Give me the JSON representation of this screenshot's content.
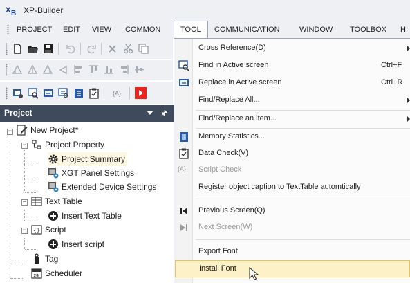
{
  "app": {
    "title": "XP-Builder"
  },
  "menubar": {
    "items": [
      {
        "label": "PROJECT"
      },
      {
        "label": "EDIT"
      },
      {
        "label": "VIEW"
      },
      {
        "label": "COMMON"
      },
      {
        "label": "TOOL"
      },
      {
        "label": "COMMUNICATION"
      },
      {
        "label": "WINDOW"
      },
      {
        "label": "TOOLBOX"
      },
      {
        "label": "HI"
      }
    ]
  },
  "project_panel": {
    "title": "Project",
    "tree": [
      {
        "label": "New Project*"
      },
      {
        "label": "Project Property"
      },
      {
        "label": "Project Summary"
      },
      {
        "label": "XGT Panel Settings"
      },
      {
        "label": "Extended Device Settings"
      },
      {
        "label": "Text Table"
      },
      {
        "label": "Insert Text Table"
      },
      {
        "label": "Script"
      },
      {
        "label": "Insert script"
      },
      {
        "label": "Tag"
      },
      {
        "label": "Scheduler"
      }
    ]
  },
  "tool_menu": {
    "items": [
      {
        "label": "Cross Reference(D)",
        "shortcut": ""
      },
      {
        "label": "Find in Active screen",
        "shortcut": "Ctrl+F"
      },
      {
        "label": "Replace in Active screen",
        "shortcut": "Ctrl+R"
      },
      {
        "label": "Find/Replace All...",
        "shortcut": ""
      },
      {
        "label": "Find/Replace an item...",
        "shortcut": ""
      },
      {
        "label": "Memory Statistics...",
        "shortcut": ""
      },
      {
        "label": "Data Check(V)",
        "shortcut": ""
      },
      {
        "label": "Script Check",
        "shortcut": ""
      },
      {
        "label": "Register object caption to TextTable automtically",
        "shortcut": ""
      },
      {
        "label": "Previous Screen(Q)",
        "shortcut": ""
      },
      {
        "label": "Next Screen(W)",
        "shortcut": ""
      },
      {
        "label": "Export Font",
        "shortcut": ""
      },
      {
        "label": "Install Font",
        "shortcut": ""
      }
    ],
    "script_check_icon_text": "{A}"
  },
  "toolbar": {
    "label_button_text": "{A}"
  },
  "colors": {
    "panel_header": "#3f4a5c",
    "menu_highlight": "#fdf1c7",
    "menu_highlight_border": "#e5c365",
    "chrome": "#eef0f4"
  }
}
